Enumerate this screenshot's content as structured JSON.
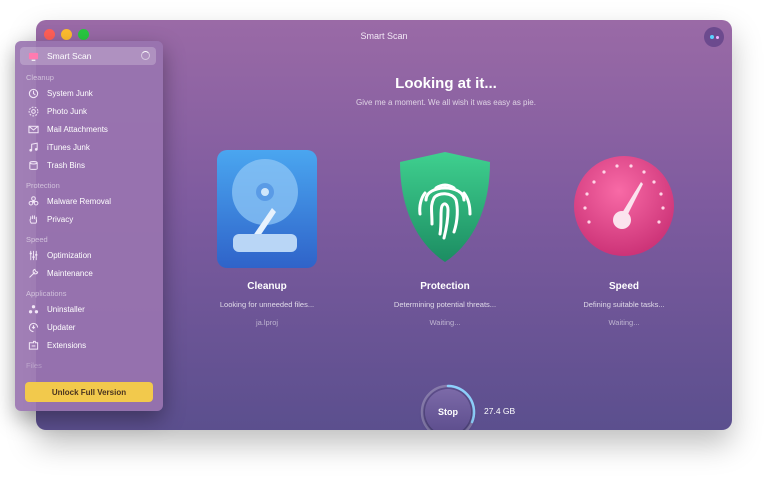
{
  "window": {
    "title": "Smart Scan"
  },
  "sidebar": {
    "active": {
      "label": "Smart Scan",
      "icon": "monitor-icon"
    },
    "sections": [
      {
        "title": "Cleanup",
        "items": [
          {
            "label": "System Junk",
            "icon": "system-junk-icon"
          },
          {
            "label": "Photo Junk",
            "icon": "photo-junk-icon"
          },
          {
            "label": "Mail Attachments",
            "icon": "mail-icon"
          },
          {
            "label": "iTunes Junk",
            "icon": "music-note-icon"
          },
          {
            "label": "Trash Bins",
            "icon": "trash-icon"
          }
        ]
      },
      {
        "title": "Protection",
        "items": [
          {
            "label": "Malware Removal",
            "icon": "biohazard-icon"
          },
          {
            "label": "Privacy",
            "icon": "hand-icon"
          }
        ]
      },
      {
        "title": "Speed",
        "items": [
          {
            "label": "Optimization",
            "icon": "sliders-icon"
          },
          {
            "label": "Maintenance",
            "icon": "wrench-icon"
          }
        ]
      },
      {
        "title": "Applications",
        "items": [
          {
            "label": "Uninstaller",
            "icon": "uninstaller-icon"
          },
          {
            "label": "Updater",
            "icon": "updater-icon"
          },
          {
            "label": "Extensions",
            "icon": "extensions-icon"
          }
        ]
      },
      {
        "title": "Files",
        "items": []
      }
    ],
    "unlock_label": "Unlock Full Version"
  },
  "main": {
    "heading": "Looking at it...",
    "subheading": "Give me a moment. We all wish it was easy as pie.",
    "modules": [
      {
        "title": "Cleanup",
        "status": "Looking for unneeded files...",
        "detail": "ja.lproj",
        "icon": "hard-drive-icon"
      },
      {
        "title": "Protection",
        "status": "Determining potential threats...",
        "detail": "Waiting...",
        "icon": "fingerprint-shield-icon"
      },
      {
        "title": "Speed",
        "status": "Defining suitable tasks...",
        "detail": "Waiting...",
        "icon": "speedometer-icon"
      }
    ],
    "stop_label": "Stop",
    "scanned_size": "27.4 GB"
  },
  "colors": {
    "window_top": "#9a6aa6",
    "window_bottom": "#5b4f8e",
    "unlock_button": "#f2c94c",
    "cleanup_icon": "#3f8fe0",
    "protection_icon": "#2cb57e",
    "speed_icon": "#e8458c"
  }
}
